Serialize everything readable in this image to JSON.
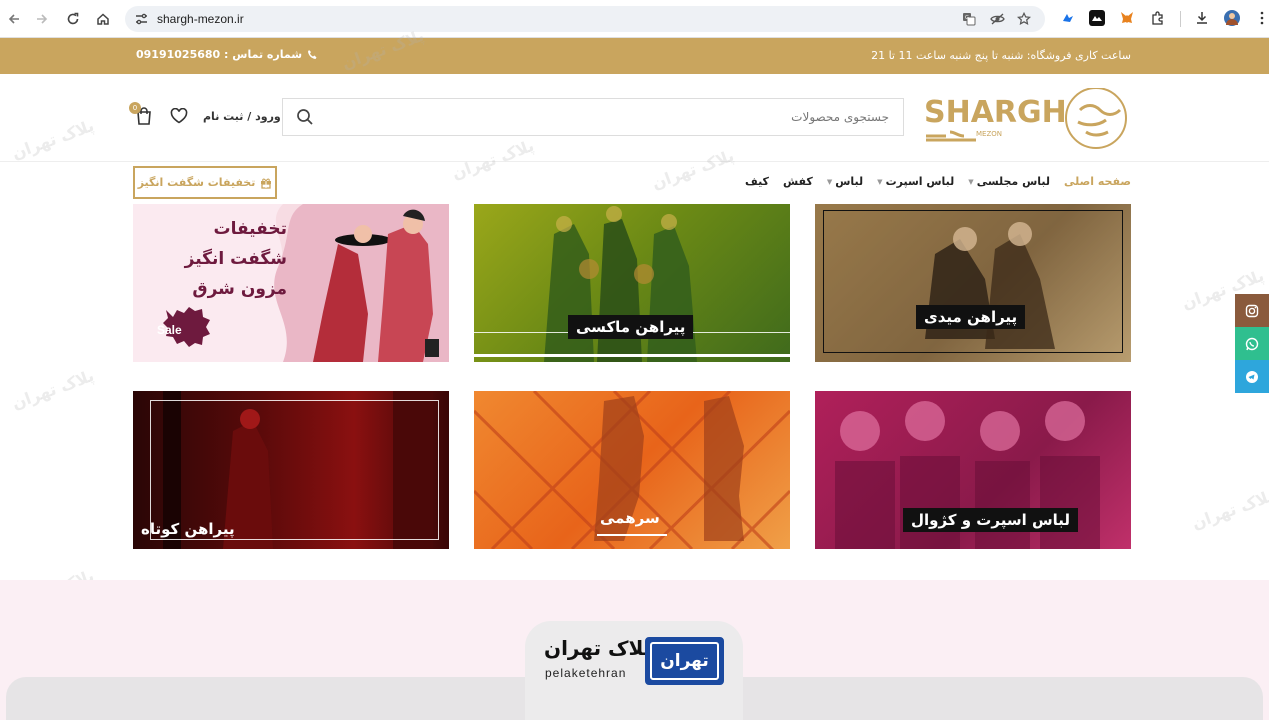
{
  "browser": {
    "url": "shargh-mezon.ir",
    "icons": [
      "back-icon",
      "forward-icon",
      "reload-icon",
      "home-icon",
      "site-settings-icon",
      "translate-icon",
      "eye-off-icon",
      "star-icon",
      "extensions-icon",
      "download-icon",
      "profile-avatar",
      "menu-dots-icon"
    ]
  },
  "topbar": {
    "hours": "ساعت کاری فروشگاه: شنبه تا پنج شنبه ساعت 11 تا 21",
    "phone": "شماره تماس : 09191025680"
  },
  "header": {
    "logo_text": "SHARGH",
    "logo_sub": "MEZON",
    "search_placeholder": "جستجوی محصولات",
    "login": "ورود / ثبت نام",
    "cart_count": "0"
  },
  "menu": {
    "items": [
      {
        "label": "صفحه اصلی",
        "active": true,
        "has_caret": false
      },
      {
        "label": "لباس مجلسی",
        "active": false,
        "has_caret": true
      },
      {
        "label": "لباس اسپرت",
        "active": false,
        "has_caret": true
      },
      {
        "label": "لباس",
        "active": false,
        "has_caret": true
      },
      {
        "label": "کفش",
        "active": false,
        "has_caret": false
      },
      {
        "label": "کیف",
        "active": false,
        "has_caret": false
      }
    ],
    "promo_button": "تخفیفات شگفت انگیز"
  },
  "tiles": {
    "promo": {
      "line1": "تخفیفات",
      "line2": "شگفت انگیز",
      "line3": "مزون شرق",
      "badge": "Sale"
    },
    "maxi": "پیراهن ماکسی",
    "midi": "پیراهن میدی",
    "short": "پیراهن کوتاه",
    "jumpsuit": "سرهمی",
    "sport": "لباس اسپرت و کژوال"
  },
  "social": [
    "instagram-icon",
    "whatsapp-icon",
    "telegram-icon"
  ],
  "watermark": {
    "name": "پلاک تهران",
    "latin": "pelaketehran",
    "plate": "تهران"
  },
  "colors": {
    "gold": "#c9a55e",
    "plate_blue": "#1b4aa0",
    "pink_bg": "#fbeff4"
  }
}
